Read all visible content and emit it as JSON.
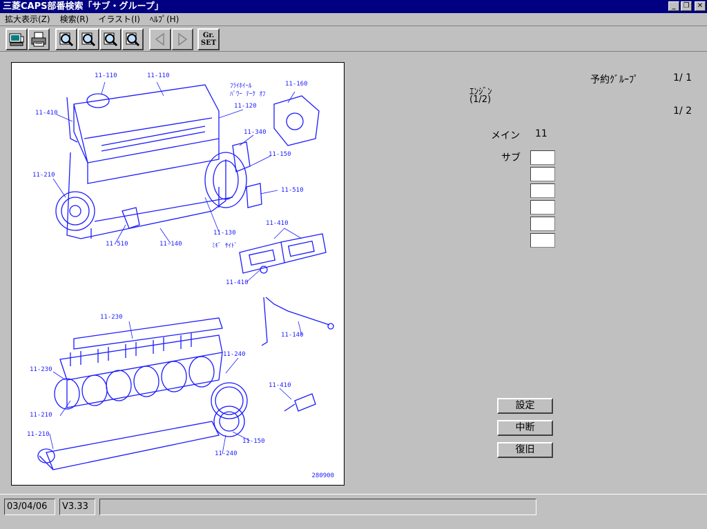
{
  "window": {
    "title": "三菱CAPS部番検索「サブ・グループ」",
    "buttons": {
      "minimize": "_",
      "restore": "❐",
      "close": "✕"
    }
  },
  "menu": [
    {
      "label": "拡大表示(Z)"
    },
    {
      "label": "検索(R)"
    },
    {
      "label": "イラスト(I)"
    },
    {
      "label": "ﾍﾙﾌﾟ(H)"
    }
  ],
  "toolbar": {
    "gr_set_label_1": "Gr.",
    "gr_set_label_2": "SET"
  },
  "drawing": {
    "callouts": [
      "11-110",
      "11-110",
      "11-410",
      "ﾌﾗｲﾎｲｰﾙ",
      "ﾊﾟﾜｰ ﾃｰｸ ｵﾌ",
      "11-160",
      "11-120",
      "11-340",
      "11-150",
      "11-210",
      "11-510",
      "11-510",
      "11-130",
      "11-140",
      "ﾐｷﾞ ｻｲﾄﾞ",
      "11-410",
      "11-410",
      "11-230",
      "11-140",
      "11-240",
      "11-230",
      "11-410",
      "11-210",
      "11-210",
      "11-150",
      "11-240"
    ],
    "drawing_number": "280900"
  },
  "info": {
    "reserved_group_label": "予約ｸﾞﾙｰﾌﾟ",
    "reserved_group_page": "1/ 1",
    "engine_label": "ｴﾝｼﾞﾝ",
    "engine_sub": "(1/2)",
    "page": "1/ 2",
    "main_label": "メイン",
    "main_value": "11",
    "sub_label": "サブ",
    "sub_boxes": [
      "",
      "",
      "",
      "",
      "",
      ""
    ]
  },
  "buttons": {
    "settings": "設定",
    "interrupt": "中断",
    "restore": "復旧"
  },
  "status": {
    "date": "03/04/06",
    "version": "V3.33",
    "message": ""
  },
  "colors": {
    "title_bar": "#000080",
    "drawing_ink": "#1a1aff",
    "face": "#c0c0c0"
  }
}
